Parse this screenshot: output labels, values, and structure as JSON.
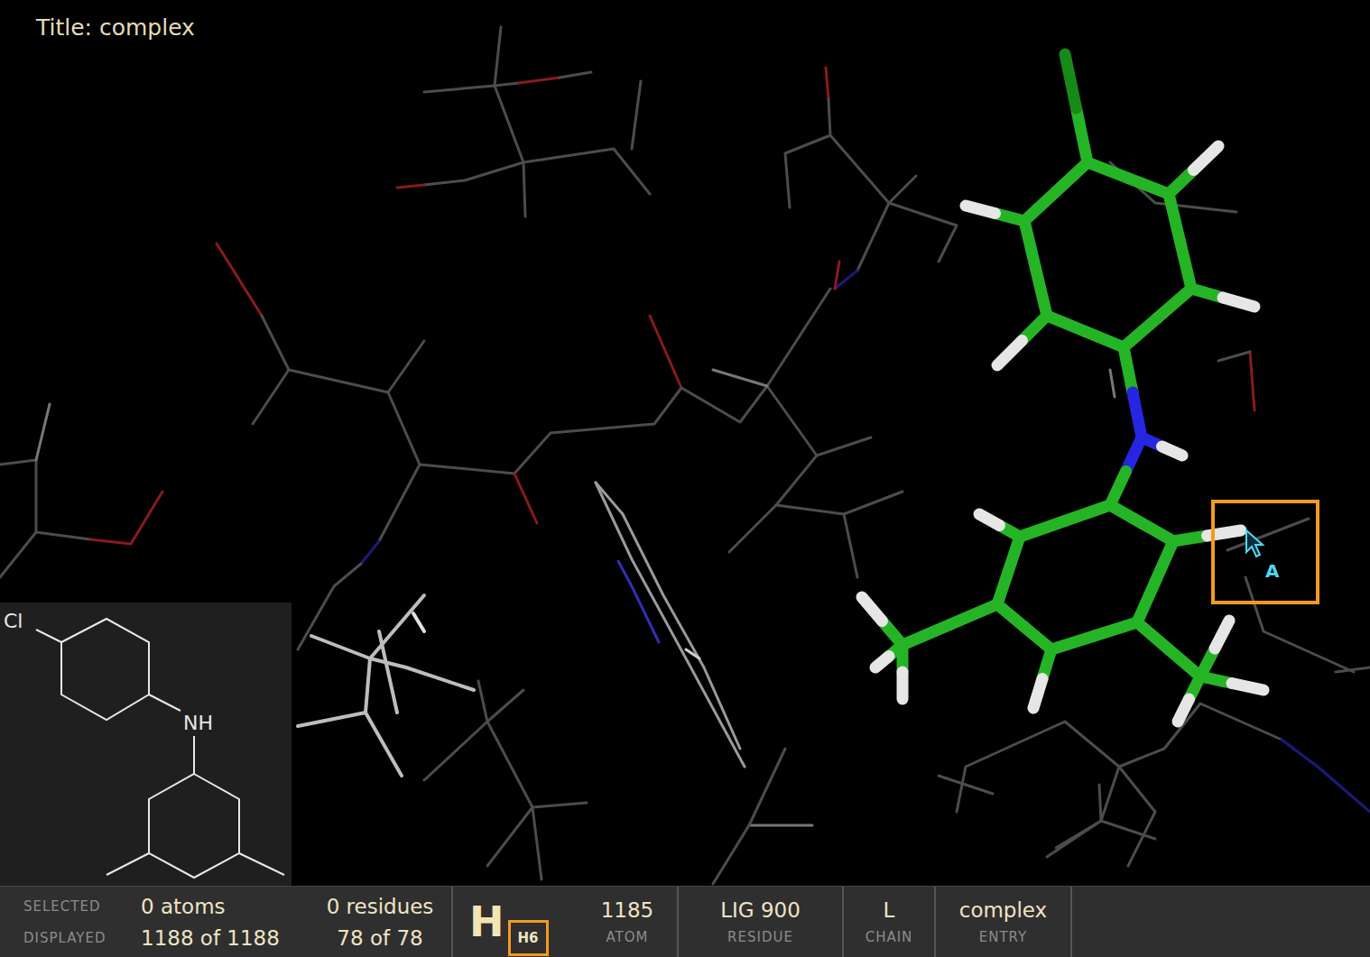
{
  "window": {
    "title": "Title: complex"
  },
  "structure_2d": {
    "labels": [
      "Cl",
      "NH"
    ]
  },
  "cursor": {
    "label": "A",
    "highlighted": true
  },
  "status_bar": {
    "rows": [
      {
        "label": "SELECTED",
        "atoms": "0 atoms",
        "residues": "0 residues"
      },
      {
        "label": "DISPLAYED",
        "atoms": "1188 of 1188",
        "residues": "78 of 78"
      }
    ],
    "element": "H",
    "atom_name": "H6",
    "atom_name_highlighted": true,
    "fields": [
      {
        "value": "1185",
        "label": "ATOM"
      },
      {
        "value": "LIG 900",
        "label": "RESIDUE"
      },
      {
        "value": "L",
        "label": "CHAIN"
      },
      {
        "value": "complex",
        "label": "ENTRY"
      }
    ]
  }
}
